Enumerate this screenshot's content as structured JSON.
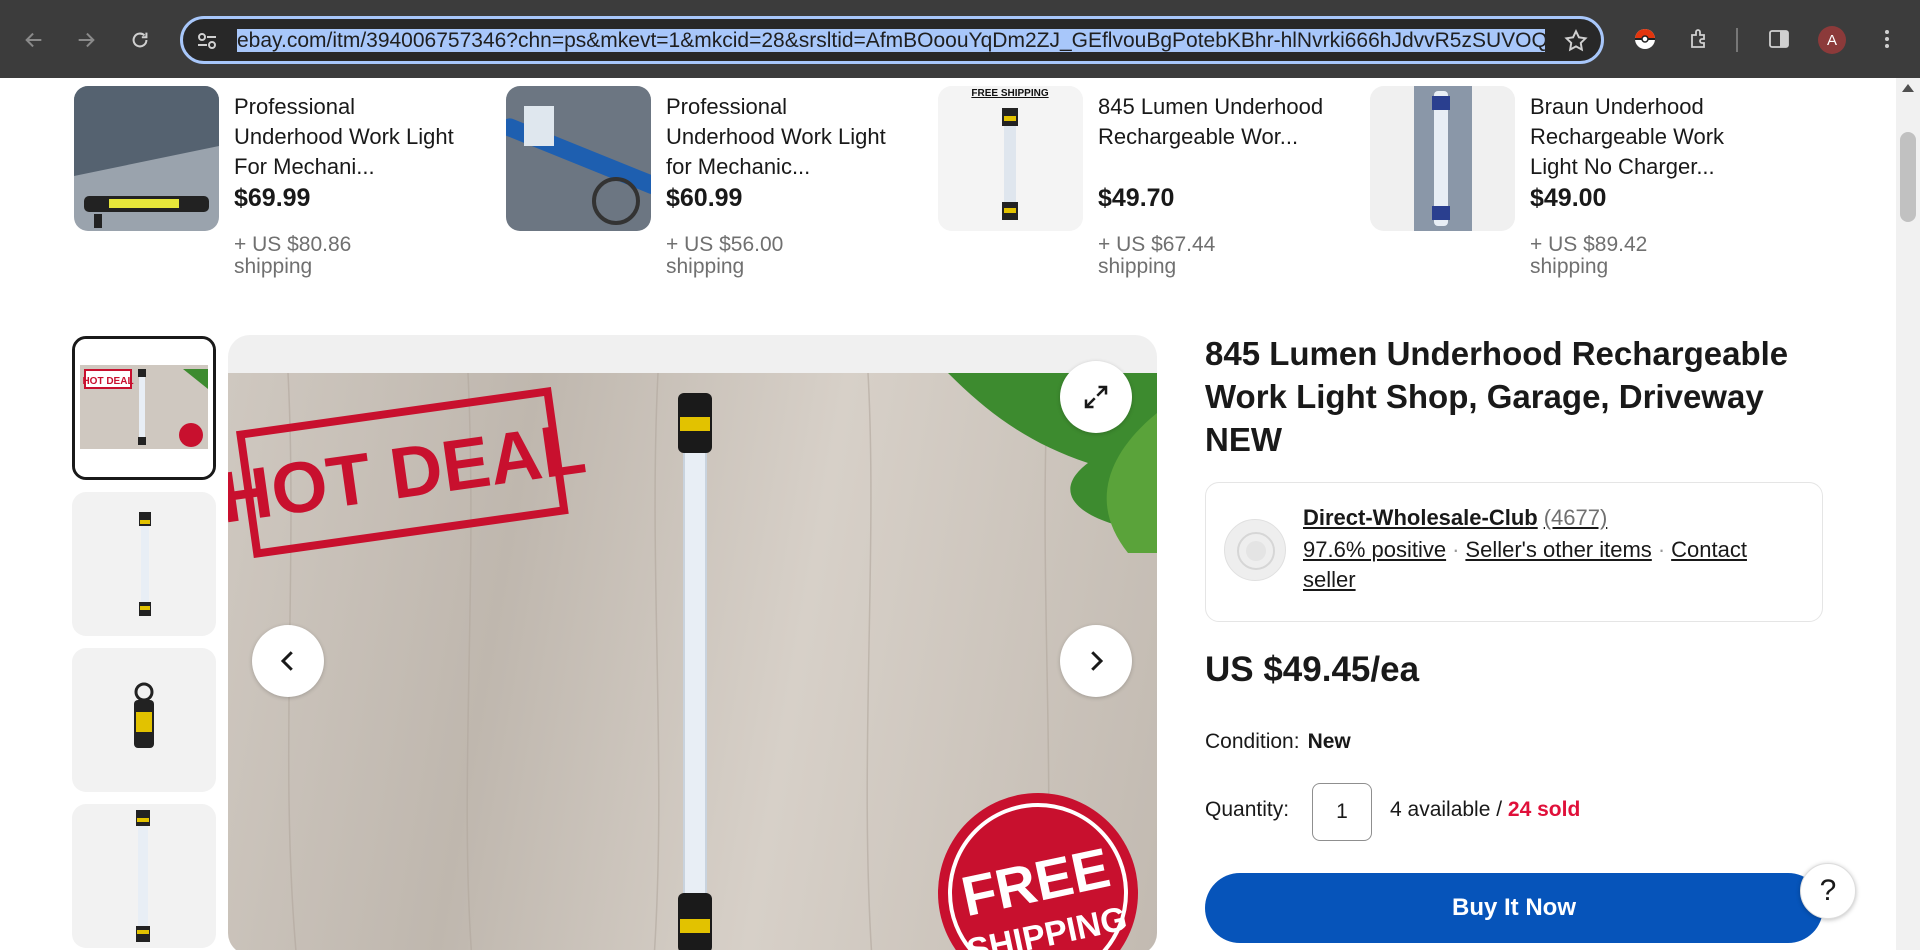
{
  "browser": {
    "url": "ebay.com/itm/394006757346?chn=ps&mkevt=1&mkcid=28&srsltid=AfmBOoouYqDm2ZJ_GEflvouBgPotebKBhr-hlNvrki666hJdvvR5zSUVOQc",
    "avatar_letter": "A"
  },
  "similar_items": [
    {
      "title": "Professional Underhood Work Light For Mechani...",
      "price": "$69.99",
      "shipping": "+ US $80.86 shipping"
    },
    {
      "title": "Professional Underhood Work Light for Mechanic...",
      "price": "$60.99",
      "shipping": "+ US $56.00 shipping"
    },
    {
      "title": "845 Lumen Underhood Rechargeable Wor...",
      "price": "$49.70",
      "shipping": "+ US $67.44 shipping",
      "badge": "FREE SHIPPING"
    },
    {
      "title": "Braun Underhood Rechargeable Work Light No Charger...",
      "price": "$49.00",
      "shipping": "+ US $89.42 shipping"
    }
  ],
  "gallery": {
    "thumb1_badge": "HOT DEAL",
    "main_badge_top": "HOT DEAL",
    "main_badge_bottom_1": "FREE",
    "main_badge_bottom_2": "SHIPPING"
  },
  "listing": {
    "title": "845 Lumen Underhood Rechargeable Work Light Shop, Garage, Driveway NEW",
    "seller": {
      "name": "Direct-Wholesale-Club",
      "count": "(4677)",
      "positive": "97.6% positive",
      "other_items": "Seller's other items",
      "contact": "Contact seller"
    },
    "price": "US $49.45/ea",
    "condition_label": "Condition:",
    "condition_value": "New",
    "quantity_label": "Quantity:",
    "quantity_value": "1",
    "available": "4 available / ",
    "sold": "24 sold",
    "buy_label": "Buy It Now",
    "help_label": "?"
  }
}
